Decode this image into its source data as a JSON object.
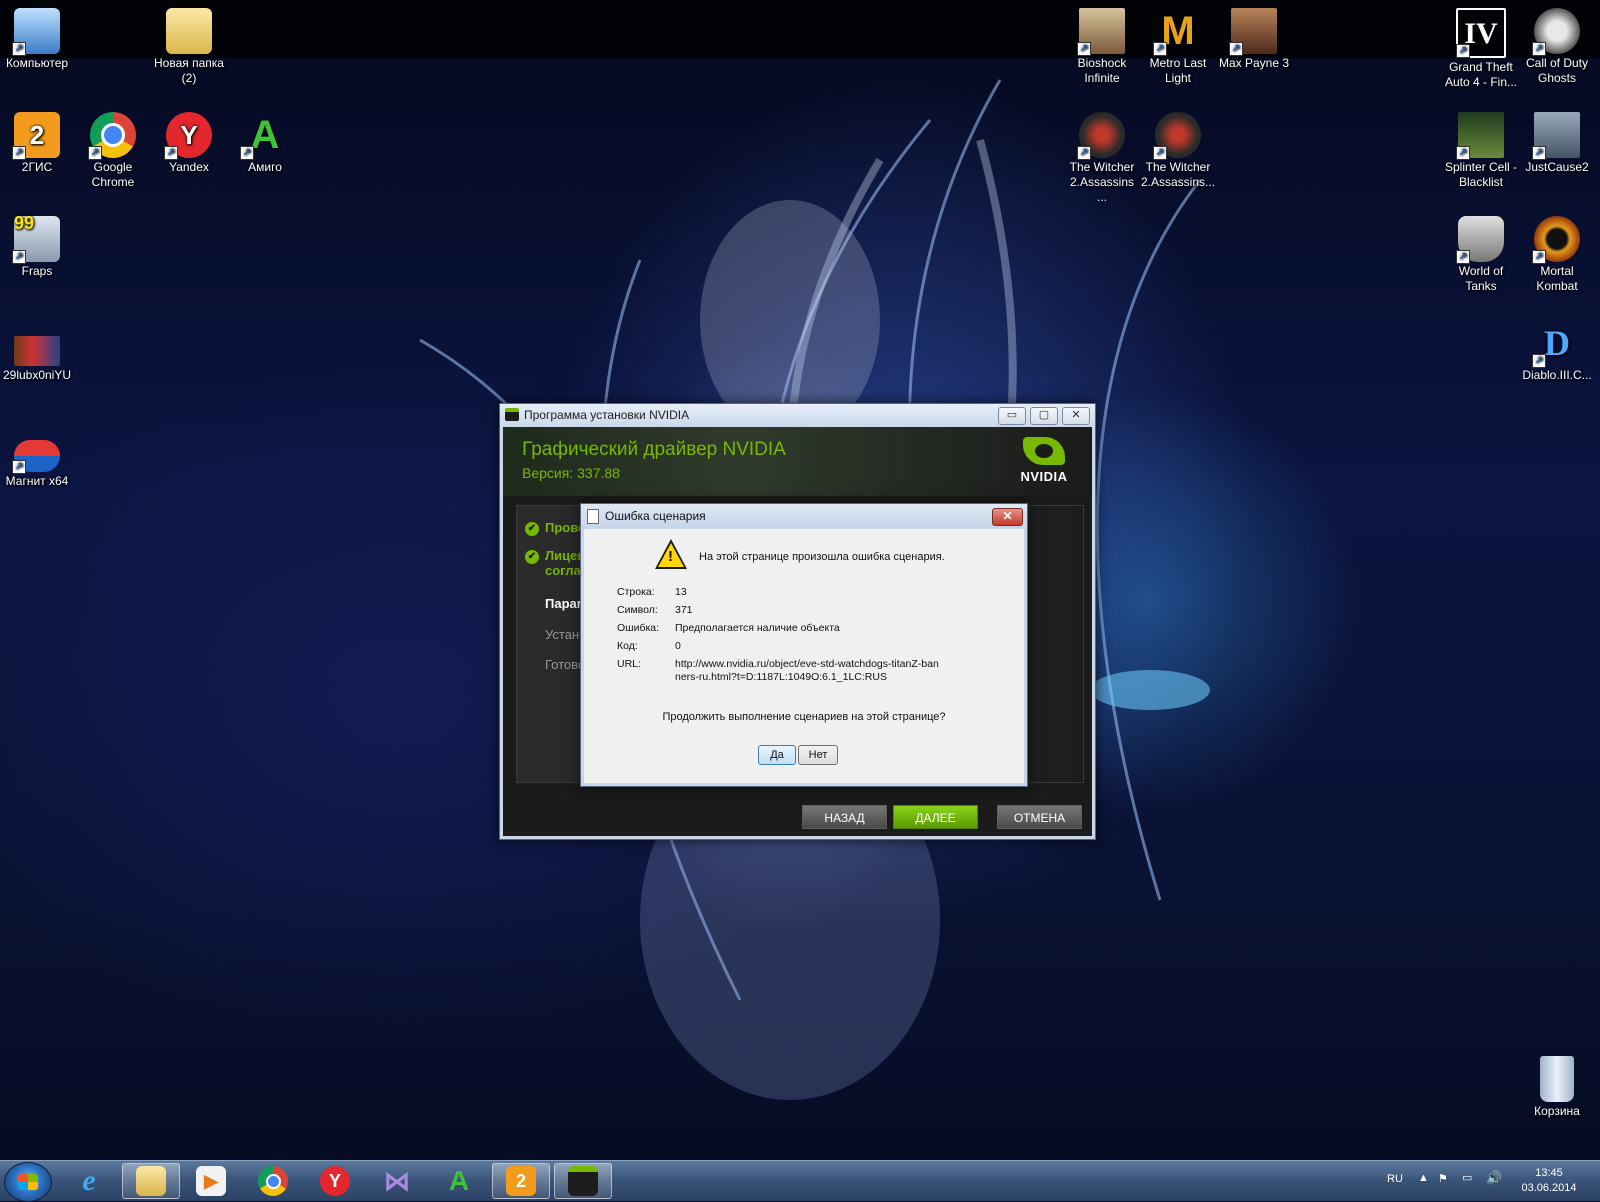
{
  "desktop": {
    "icons": [
      {
        "label": "Компьютер"
      },
      {
        "label": "Новая папка (2)"
      },
      {
        "label": "2ГИС"
      },
      {
        "label": "Google Chrome"
      },
      {
        "label": "Yandex"
      },
      {
        "label": "Амиго"
      },
      {
        "label": "Fraps"
      },
      {
        "label": "29lubx0niYU"
      },
      {
        "label": "Магнит x64"
      },
      {
        "label": "Bioshock Infinite"
      },
      {
        "label": "Metro Last Light"
      },
      {
        "label": "Max Payne 3"
      },
      {
        "label": "The Witcher 2.Assassins ..."
      },
      {
        "label": "The Witcher 2.Assassins..."
      },
      {
        "label": "Grand Theft Auto 4 - Fin..."
      },
      {
        "label": "Call of Duty Ghosts"
      },
      {
        "label": "Splinter Cell - Blacklist"
      },
      {
        "label": "JustCause2"
      },
      {
        "label": "World of Tanks"
      },
      {
        "label": "Mortal Kombat"
      },
      {
        "label": "Diablo.III.C..."
      },
      {
        "label": "Корзина"
      }
    ]
  },
  "nvidia": {
    "window_title": "Программа установки NVIDIA",
    "product_title": "Графический драйвер NVIDIA",
    "version": "Версия: 337.88",
    "logo_text": "NVIDIA",
    "steps": [
      "Прове",
      "Лицен",
      "соглас",
      "Парам",
      "Устано",
      "Готово"
    ],
    "buttons": {
      "back": "НАЗАД",
      "next": "ДАЛЕЕ",
      "cancel": "ОТМЕНА"
    },
    "window_controls": {
      "minimize": "▭",
      "maximize": "▢",
      "close": "✕"
    }
  },
  "script_error": {
    "title": "Ошибка сценария",
    "message": "На этой странице произошла ошибка сценария.",
    "fields": [
      {
        "label": "Строка:",
        "value": "13"
      },
      {
        "label": "Символ:",
        "value": "371"
      },
      {
        "label": "Ошибка:",
        "value": "Предполагается наличие объекта"
      },
      {
        "label": "Код:",
        "value": "0"
      },
      {
        "label": "URL:",
        "value": "http://www.nvidia.ru/object/eve-std-watchdogs-titanZ-banners-ru.html?t=D:1187L:1049O:6.1_1LC:RUS"
      }
    ],
    "question": "Продолжить выполнение сценариев на этой странице?",
    "yes": "Да",
    "no": "Нет",
    "close": "✕"
  },
  "taskbar": {
    "language": "RU",
    "time": "13:45",
    "date": "03.06.2014",
    "apps": [
      "Internet Explorer",
      "Проводник",
      "Media Player",
      "Google Chrome",
      "Yandex",
      "Visual Studio",
      "Амиго",
      "2ГИС",
      "NVIDIA"
    ]
  }
}
